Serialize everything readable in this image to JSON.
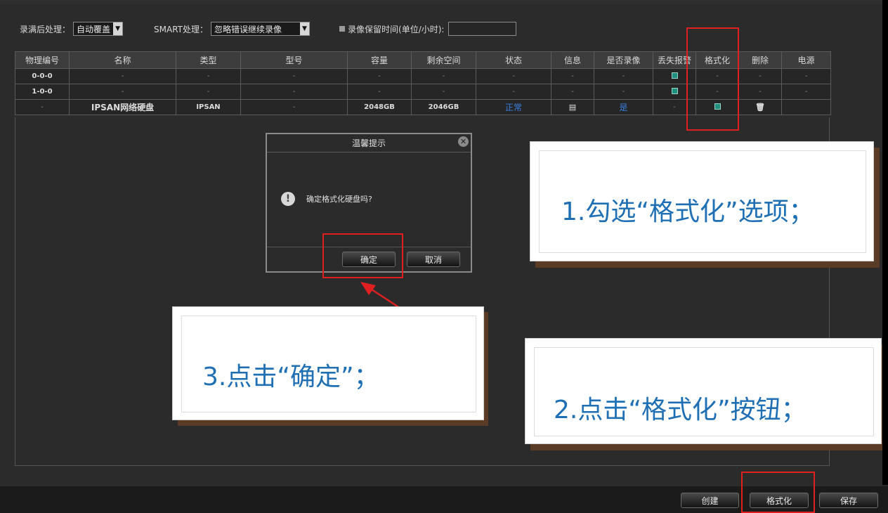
{
  "toolbar": {
    "record_full_label": "录满后处理：",
    "record_full_value": "自动覆盖",
    "smart_label": "SMART处理：",
    "smart_value": "忽略错误继续录像",
    "retain_label": "录像保留时间(单位/小时):",
    "retain_value": ""
  },
  "table": {
    "headers": [
      "物理编号",
      "名称",
      "类型",
      "型号",
      "容量",
      "剩余空间",
      "状态",
      "信息",
      "是否录像",
      "丢失报警",
      "格式化",
      "删除",
      "电源"
    ],
    "rows": [
      {
        "id": "0-0-0",
        "name": "-",
        "type": "-",
        "model": "-",
        "capacity": "-",
        "free": "-",
        "status": "-",
        "info": "-",
        "recording": "-",
        "loss_alarm": "checked",
        "format": "-",
        "delete": "-",
        "power": "-"
      },
      {
        "id": "1-0-0",
        "name": "-",
        "type": "-",
        "model": "-",
        "capacity": "-",
        "free": "-",
        "status": "-",
        "info": "-",
        "recording": "-",
        "loss_alarm": "checked",
        "format": "-",
        "delete": "-",
        "power": "-"
      },
      {
        "id": "-",
        "name": "IPSAN网络硬盘",
        "type": "IPSAN",
        "model": "-",
        "capacity": "2048GB",
        "free": "2046GB",
        "status": "正常",
        "info": "file-icon",
        "recording": "是",
        "loss_alarm": "-",
        "format": "checked",
        "delete": "trash-icon",
        "power": ""
      }
    ]
  },
  "dialog": {
    "title": "温馨提示",
    "message": "确定格式化硬盘吗?",
    "ok_label": "确定",
    "cancel_label": "取消"
  },
  "buttons": {
    "create": "创建",
    "format": "格式化",
    "save": "保存"
  },
  "callouts": {
    "step1": "1.勾选“格式化”选项；",
    "step2": "2.点击“格式化”按钮；",
    "step3": "3.点击“确定”；"
  },
  "colors": {
    "highlight": "#e02020",
    "callout_text": "#1f6fb5",
    "status_blue": "#3a7fe0"
  }
}
